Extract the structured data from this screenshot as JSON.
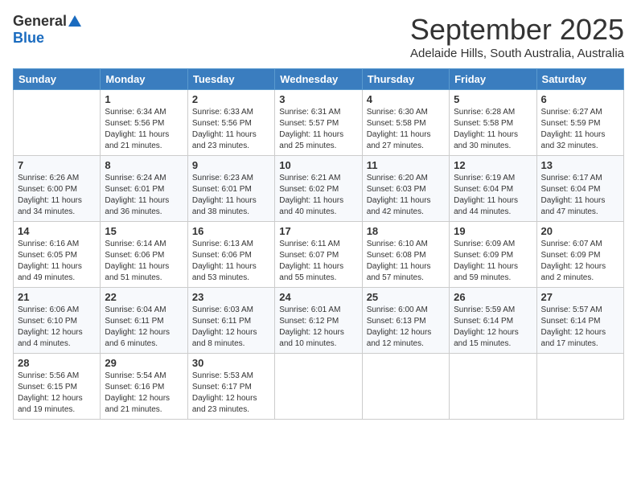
{
  "logo": {
    "general": "General",
    "blue": "Blue"
  },
  "header": {
    "month": "September 2025",
    "location": "Adelaide Hills, South Australia, Australia"
  },
  "weekdays": [
    "Sunday",
    "Monday",
    "Tuesday",
    "Wednesday",
    "Thursday",
    "Friday",
    "Saturday"
  ],
  "weeks": [
    [
      {
        "day": "",
        "info": ""
      },
      {
        "day": "1",
        "info": "Sunrise: 6:34 AM\nSunset: 5:56 PM\nDaylight: 11 hours\nand 21 minutes."
      },
      {
        "day": "2",
        "info": "Sunrise: 6:33 AM\nSunset: 5:56 PM\nDaylight: 11 hours\nand 23 minutes."
      },
      {
        "day": "3",
        "info": "Sunrise: 6:31 AM\nSunset: 5:57 PM\nDaylight: 11 hours\nand 25 minutes."
      },
      {
        "day": "4",
        "info": "Sunrise: 6:30 AM\nSunset: 5:58 PM\nDaylight: 11 hours\nand 27 minutes."
      },
      {
        "day": "5",
        "info": "Sunrise: 6:28 AM\nSunset: 5:58 PM\nDaylight: 11 hours\nand 30 minutes."
      },
      {
        "day": "6",
        "info": "Sunrise: 6:27 AM\nSunset: 5:59 PM\nDaylight: 11 hours\nand 32 minutes."
      }
    ],
    [
      {
        "day": "7",
        "info": "Sunrise: 6:26 AM\nSunset: 6:00 PM\nDaylight: 11 hours\nand 34 minutes."
      },
      {
        "day": "8",
        "info": "Sunrise: 6:24 AM\nSunset: 6:01 PM\nDaylight: 11 hours\nand 36 minutes."
      },
      {
        "day": "9",
        "info": "Sunrise: 6:23 AM\nSunset: 6:01 PM\nDaylight: 11 hours\nand 38 minutes."
      },
      {
        "day": "10",
        "info": "Sunrise: 6:21 AM\nSunset: 6:02 PM\nDaylight: 11 hours\nand 40 minutes."
      },
      {
        "day": "11",
        "info": "Sunrise: 6:20 AM\nSunset: 6:03 PM\nDaylight: 11 hours\nand 42 minutes."
      },
      {
        "day": "12",
        "info": "Sunrise: 6:19 AM\nSunset: 6:04 PM\nDaylight: 11 hours\nand 44 minutes."
      },
      {
        "day": "13",
        "info": "Sunrise: 6:17 AM\nSunset: 6:04 PM\nDaylight: 11 hours\nand 47 minutes."
      }
    ],
    [
      {
        "day": "14",
        "info": "Sunrise: 6:16 AM\nSunset: 6:05 PM\nDaylight: 11 hours\nand 49 minutes."
      },
      {
        "day": "15",
        "info": "Sunrise: 6:14 AM\nSunset: 6:06 PM\nDaylight: 11 hours\nand 51 minutes."
      },
      {
        "day": "16",
        "info": "Sunrise: 6:13 AM\nSunset: 6:06 PM\nDaylight: 11 hours\nand 53 minutes."
      },
      {
        "day": "17",
        "info": "Sunrise: 6:11 AM\nSunset: 6:07 PM\nDaylight: 11 hours\nand 55 minutes."
      },
      {
        "day": "18",
        "info": "Sunrise: 6:10 AM\nSunset: 6:08 PM\nDaylight: 11 hours\nand 57 minutes."
      },
      {
        "day": "19",
        "info": "Sunrise: 6:09 AM\nSunset: 6:09 PM\nDaylight: 11 hours\nand 59 minutes."
      },
      {
        "day": "20",
        "info": "Sunrise: 6:07 AM\nSunset: 6:09 PM\nDaylight: 12 hours\nand 2 minutes."
      }
    ],
    [
      {
        "day": "21",
        "info": "Sunrise: 6:06 AM\nSunset: 6:10 PM\nDaylight: 12 hours\nand 4 minutes."
      },
      {
        "day": "22",
        "info": "Sunrise: 6:04 AM\nSunset: 6:11 PM\nDaylight: 12 hours\nand 6 minutes."
      },
      {
        "day": "23",
        "info": "Sunrise: 6:03 AM\nSunset: 6:11 PM\nDaylight: 12 hours\nand 8 minutes."
      },
      {
        "day": "24",
        "info": "Sunrise: 6:01 AM\nSunset: 6:12 PM\nDaylight: 12 hours\nand 10 minutes."
      },
      {
        "day": "25",
        "info": "Sunrise: 6:00 AM\nSunset: 6:13 PM\nDaylight: 12 hours\nand 12 minutes."
      },
      {
        "day": "26",
        "info": "Sunrise: 5:59 AM\nSunset: 6:14 PM\nDaylight: 12 hours\nand 15 minutes."
      },
      {
        "day": "27",
        "info": "Sunrise: 5:57 AM\nSunset: 6:14 PM\nDaylight: 12 hours\nand 17 minutes."
      }
    ],
    [
      {
        "day": "28",
        "info": "Sunrise: 5:56 AM\nSunset: 6:15 PM\nDaylight: 12 hours\nand 19 minutes."
      },
      {
        "day": "29",
        "info": "Sunrise: 5:54 AM\nSunset: 6:16 PM\nDaylight: 12 hours\nand 21 minutes."
      },
      {
        "day": "30",
        "info": "Sunrise: 5:53 AM\nSunset: 6:17 PM\nDaylight: 12 hours\nand 23 minutes."
      },
      {
        "day": "",
        "info": ""
      },
      {
        "day": "",
        "info": ""
      },
      {
        "day": "",
        "info": ""
      },
      {
        "day": "",
        "info": ""
      }
    ]
  ]
}
